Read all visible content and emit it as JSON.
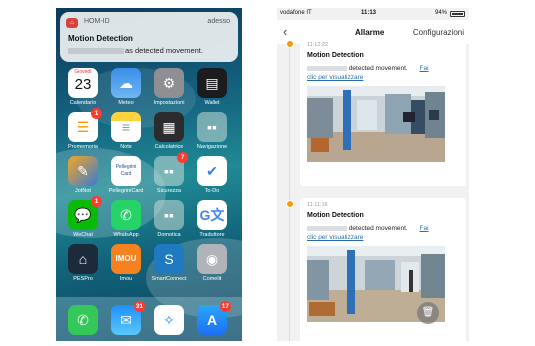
{
  "left_phone": {
    "notification": {
      "app_name": "HOM-ID",
      "time": "adesso",
      "title": "Motion Detection",
      "body": "as detected movement."
    },
    "apps": [
      {
        "label": "Calendario",
        "icon": "calendar-icon",
        "icon_text": "23",
        "icon_day": "Giovedì",
        "badge": ""
      },
      {
        "label": "Meteo",
        "icon": "weather-icon",
        "badge": ""
      },
      {
        "label": "Impostazioni",
        "icon": "settings-gear-icon",
        "badge": ""
      },
      {
        "label": "Wallet",
        "icon": "wallet-icon",
        "badge": ""
      },
      {
        "label": "Promemoria",
        "icon": "reminders-icon",
        "badge": "1"
      },
      {
        "label": "Note",
        "icon": "notes-icon",
        "badge": ""
      },
      {
        "label": "Calcolatrice",
        "icon": "calculator-icon",
        "badge": ""
      },
      {
        "label": "Navigazione",
        "icon": "folder-icon",
        "badge": ""
      },
      {
        "label": "JotNot",
        "icon": "scanner-icon",
        "badge": ""
      },
      {
        "label": "PellegriniCard",
        "icon": "card-icon",
        "icon_text": "Pellegrini Card",
        "badge": ""
      },
      {
        "label": "Sicurezza",
        "icon": "folder-icon",
        "badge": "7"
      },
      {
        "label": "To-Do",
        "icon": "checkmark-icon",
        "badge": ""
      },
      {
        "label": "WeChat",
        "icon": "wechat-icon",
        "badge": "1"
      },
      {
        "label": "WhatsApp",
        "icon": "whatsapp-icon",
        "badge": ""
      },
      {
        "label": "Domotica",
        "icon": "folder-icon",
        "badge": ""
      },
      {
        "label": "Traduttore",
        "icon": "translate-icon",
        "badge": ""
      },
      {
        "label": "PESPro",
        "icon": "home-icon",
        "badge": ""
      },
      {
        "label": "Imou",
        "icon": "imou-icon",
        "icon_text": "IMOU",
        "badge": ""
      },
      {
        "label": "SmartConnect",
        "icon": "smartconnect-icon",
        "badge": ""
      },
      {
        "label": "Comelit",
        "icon": "camera-icon",
        "badge": ""
      }
    ],
    "dock": [
      {
        "label": "Telefono",
        "icon": "phone-icon",
        "badge": ""
      },
      {
        "label": "Mail",
        "icon": "mail-icon",
        "badge": "31"
      },
      {
        "label": "Safari",
        "icon": "compass-icon",
        "badge": ""
      },
      {
        "label": "App Store",
        "icon": "appstore-icon",
        "badge": "17"
      }
    ]
  },
  "right_phone": {
    "status": {
      "carrier": "vodafone IT",
      "time": "11:13",
      "battery": "94%"
    },
    "nav": {
      "back_icon": "chevron-left-icon",
      "title": "Allarme",
      "right": "Configurazioni"
    },
    "alarms": [
      {
        "time": "11:12:22",
        "title": "Motion Detection",
        "text": "detected movement.",
        "link_a": "Fai",
        "link_b": "clic per visualizzare"
      },
      {
        "time": "11:11:16",
        "title": "Motion Detection",
        "text": "detected movement.",
        "link_a": "Fai",
        "link_b": "clic per visualizzare"
      }
    ],
    "trash_icon": "trash-icon",
    "colors": {
      "accent_dot": "#f39c12",
      "link": "#2a6db5"
    }
  }
}
